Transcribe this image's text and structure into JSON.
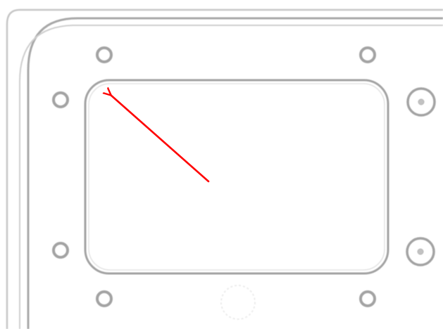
{
  "drawing": {
    "subject": "panel-outline-with-bolt-holes-and-arrow",
    "colors": {
      "background": "#ffffff",
      "line": "#a3a3a3",
      "faint_line": "#c6c6c6",
      "arrow": "#ff0000"
    },
    "bolt_hole_count": 8,
    "fastener_count": 2
  }
}
